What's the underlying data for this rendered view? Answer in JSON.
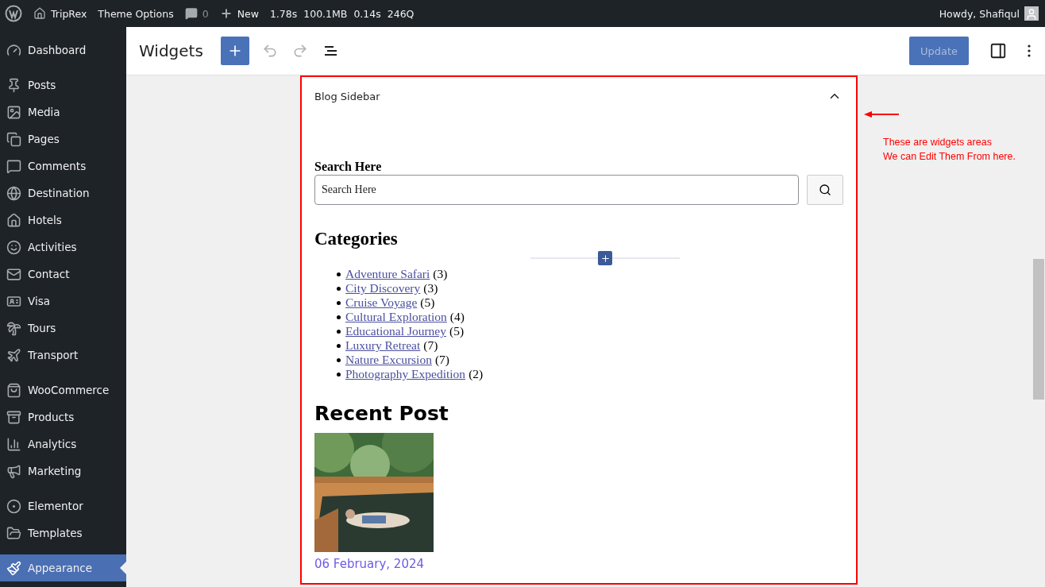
{
  "admin_bar": {
    "site": "TripRex",
    "theme_options": "Theme Options",
    "comments_count": "0",
    "new_label": "New",
    "stats": [
      "1.78s",
      "100.1MB",
      "0.14s",
      "246Q"
    ],
    "greeting": "Howdy, Shafiqul"
  },
  "sidebar": {
    "groups": [
      [
        {
          "label": "Dashboard",
          "selected": false
        }
      ],
      [
        {
          "label": "Posts",
          "selected": false
        },
        {
          "label": "Media",
          "selected": false
        },
        {
          "label": "Pages",
          "selected": false
        },
        {
          "label": "Comments",
          "selected": false
        },
        {
          "label": "Destination",
          "selected": false
        },
        {
          "label": "Hotels",
          "selected": false
        },
        {
          "label": "Activities",
          "selected": false
        },
        {
          "label": "Contact",
          "selected": false
        },
        {
          "label": "Visa",
          "selected": false
        },
        {
          "label": "Tours",
          "selected": false
        },
        {
          "label": "Transport",
          "selected": false
        }
      ],
      [
        {
          "label": "WooCommerce",
          "selected": false
        },
        {
          "label": "Products",
          "selected": false
        },
        {
          "label": "Analytics",
          "selected": false
        },
        {
          "label": "Marketing",
          "selected": false
        }
      ],
      [
        {
          "label": "Elementor",
          "selected": false
        },
        {
          "label": "Templates",
          "selected": false
        }
      ],
      [
        {
          "label": "Appearance",
          "selected": true
        }
      ]
    ]
  },
  "header": {
    "title": "Widgets",
    "undo_disabled": true,
    "redo_disabled": true,
    "update_label": "Update",
    "update_disabled": true
  },
  "widget_area": {
    "title": "Blog Sidebar",
    "expanded": true,
    "search": {
      "label": "Search Here",
      "placeholder": "Search Here"
    },
    "categories": {
      "title": "Categories",
      "items": [
        {
          "name": "Adventure Safari",
          "count": "(3)"
        },
        {
          "name": "City Discovery",
          "count": "(3)"
        },
        {
          "name": "Cruise Voyage",
          "count": "(5)"
        },
        {
          "name": "Cultural Exploration",
          "count": "(4)"
        },
        {
          "name": "Educational Journey",
          "count": "(5)"
        },
        {
          "name": "Luxury Retreat",
          "count": "(7)"
        },
        {
          "name": "Nature Excursion",
          "count": "(7)"
        },
        {
          "name": "Photography Expedition",
          "count": "(2)"
        }
      ]
    },
    "recent_post": {
      "title": "Recent Post",
      "date": "06 February, 2024"
    }
  },
  "annotation": {
    "lines": [
      "These are widgets areas",
      "We can Edit Them From here."
    ]
  }
}
